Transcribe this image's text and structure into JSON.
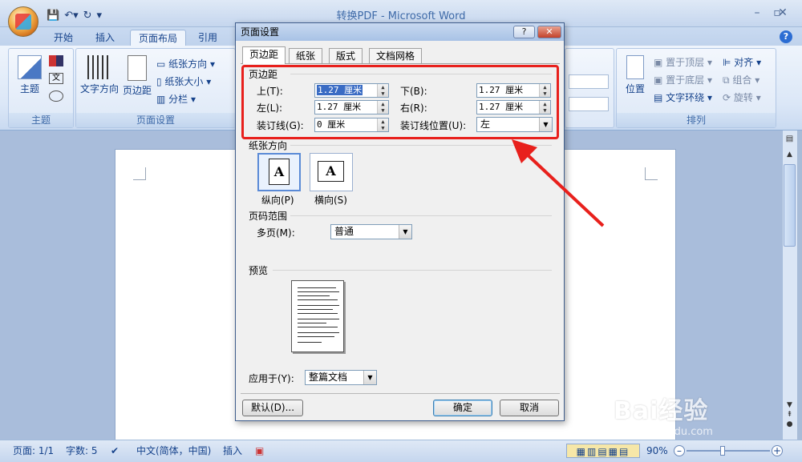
{
  "window": {
    "title": "转换PDF - Microsoft Word"
  },
  "ribbon": {
    "tabs": [
      "开始",
      "插入",
      "页面布局",
      "引用"
    ],
    "active_tab": "页面布局",
    "groups": {
      "theme": {
        "label": "主题",
        "button": "主题"
      },
      "page_setup": {
        "label": "页面设置",
        "text_direction": "文字方向",
        "margins": "页边距",
        "orientation": "纸张方向",
        "size": "纸张大小",
        "columns": "分栏"
      },
      "arrange": {
        "label": "排列",
        "position": "位置",
        "bring_front": "置于顶层",
        "send_back": "置于底层",
        "text_wrap": "文字环绕",
        "align": "对齐",
        "group": "组合",
        "rotate": "旋转"
      }
    }
  },
  "dialog": {
    "title": "页面设置",
    "help_glyph": "?",
    "close_glyph": "✕",
    "tabs": [
      "页边距",
      "纸张",
      "版式",
      "文档网格"
    ],
    "margins": {
      "section": "页边距",
      "top": {
        "label": "上(T):",
        "value": "1.27 厘米"
      },
      "bottom": {
        "label": "下(B):",
        "value": "1.27 厘米"
      },
      "left": {
        "label": "左(L):",
        "value": "1.27 厘米"
      },
      "right": {
        "label": "右(R):",
        "value": "1.27 厘米"
      },
      "gutter": {
        "label": "装订线(G):",
        "value": "0 厘米"
      },
      "gutter_pos": {
        "label": "装订线位置(U):",
        "value": "左"
      }
    },
    "orientation": {
      "section": "纸张方向",
      "portrait": "纵向(P)",
      "landscape": "横向(S)",
      "icon_letter": "A"
    },
    "pages": {
      "section": "页码范围",
      "multi_label": "多页(M):",
      "multi_value": "普通"
    },
    "preview": {
      "section": "预览"
    },
    "apply": {
      "label": "应用于(Y):",
      "value": "整篇文档"
    },
    "buttons": {
      "default": "默认(D)...",
      "ok": "确定",
      "cancel": "取消"
    }
  },
  "statusbar": {
    "page": "页面: 1/1",
    "words": "字数: 5",
    "language": "中文(简体，中国)",
    "mode": "插入",
    "zoom": "90%"
  },
  "watermark": {
    "brand": "Bai经验",
    "url": "jingyan.baidu.com"
  },
  "colors": {
    "highlight": "#e8201c",
    "accent": "#15428b"
  }
}
